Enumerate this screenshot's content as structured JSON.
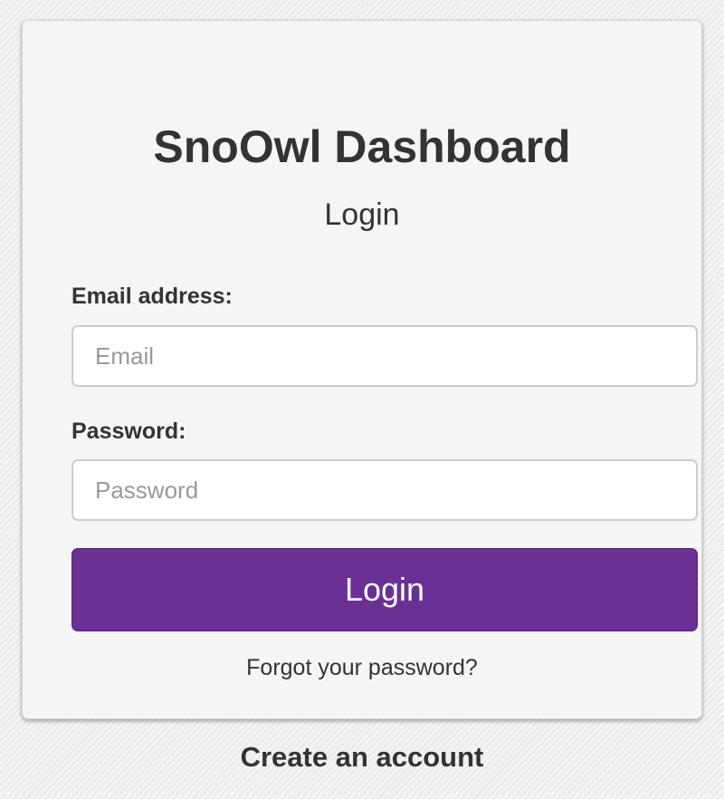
{
  "login_card": {
    "app_title": "SnoOwl Dashboard",
    "subtitle": "Login",
    "email": {
      "label": "Email address:",
      "placeholder": "Email",
      "value": ""
    },
    "password": {
      "label": "Password:",
      "placeholder": "Password",
      "value": ""
    },
    "login_button_label": "Login",
    "forgot_password_link": "Forgot your password?"
  },
  "create_account_link": "Create an account",
  "colors": {
    "primary_button": "#6a3096",
    "card_background": "#f5f5f5",
    "page_background": "#ececec",
    "text": "#333333"
  }
}
